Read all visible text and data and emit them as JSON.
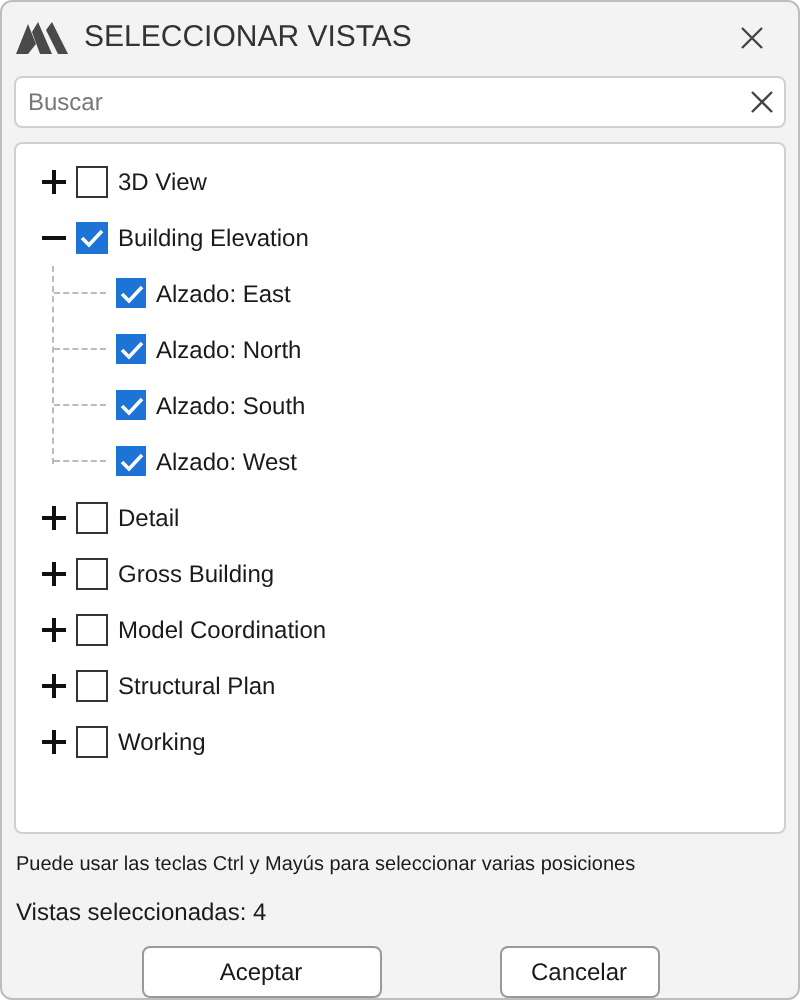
{
  "window": {
    "title": "SELECCIONAR VISTAS"
  },
  "search": {
    "placeholder": "Buscar"
  },
  "tree": [
    {
      "label": "3D View",
      "checked": false,
      "expanded": false
    },
    {
      "label": "Building Elevation",
      "checked": true,
      "expanded": true,
      "children": [
        {
          "label": "Alzado: East",
          "checked": true
        },
        {
          "label": "Alzado: North",
          "checked": true
        },
        {
          "label": "Alzado: South",
          "checked": true
        },
        {
          "label": "Alzado: West",
          "checked": true
        }
      ]
    },
    {
      "label": "Detail",
      "checked": false,
      "expanded": false
    },
    {
      "label": "Gross Building",
      "checked": false,
      "expanded": false
    },
    {
      "label": "Model Coordination",
      "checked": false,
      "expanded": false
    },
    {
      "label": "Structural Plan",
      "checked": false,
      "expanded": false
    },
    {
      "label": "Working",
      "checked": false,
      "expanded": false
    }
  ],
  "hint": "Puede usar las teclas Ctrl y Mayús para seleccionar varias posiciones",
  "selected_count": "Vistas seleccionadas: 4",
  "buttons": [
    "Aceptar",
    "Cancelar"
  ]
}
